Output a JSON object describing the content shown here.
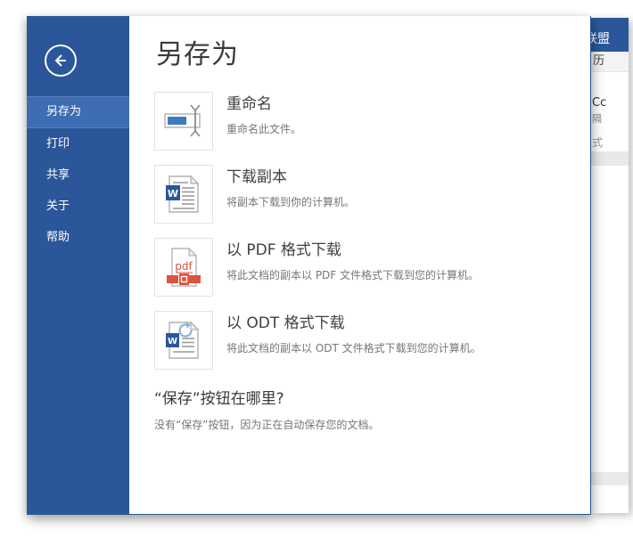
{
  "backstage": {
    "title": "另存为",
    "sidebar": {
      "items": [
        {
          "label": "另存为",
          "selected": true
        },
        {
          "label": "打印",
          "selected": false
        },
        {
          "label": "共享",
          "selected": false
        },
        {
          "label": "关于",
          "selected": false
        },
        {
          "label": "帮助",
          "selected": false
        }
      ]
    },
    "options": [
      {
        "icon": "rename-icon",
        "title": "重命名",
        "description": "重命名此文件。"
      },
      {
        "icon": "word-document-icon",
        "title": "下载副本",
        "description": "将副本下载到你的计算机。"
      },
      {
        "icon": "pdf-document-icon",
        "title": "以 PDF 格式下载",
        "description": "将此文档的副本以 PDF 文件格式下载到您的计算机。"
      },
      {
        "icon": "odt-document-icon",
        "title": "以 ODT 格式下载",
        "description": "将此文档的副本以 ODT 文件格式下载到您的计算机。"
      }
    ],
    "save_note": {
      "heading": "“保存”按钮在哪里?",
      "description": "没有“保存”按钮，因为正在自动保存您的文档。"
    }
  },
  "background_app": {
    "titlebar_text_fragment": "联盟",
    "ribbon_tab_fragment": "历",
    "style_preview_fragment": "Cc",
    "style_name_fragment": "隔",
    "styles_label_fragment": "式"
  },
  "colors": {
    "sidebar_blue": "#2b579a",
    "sidebar_selected_blue": "#3f6db3",
    "word_blue": "#2b579a",
    "pdf_red": "#dd5240"
  }
}
